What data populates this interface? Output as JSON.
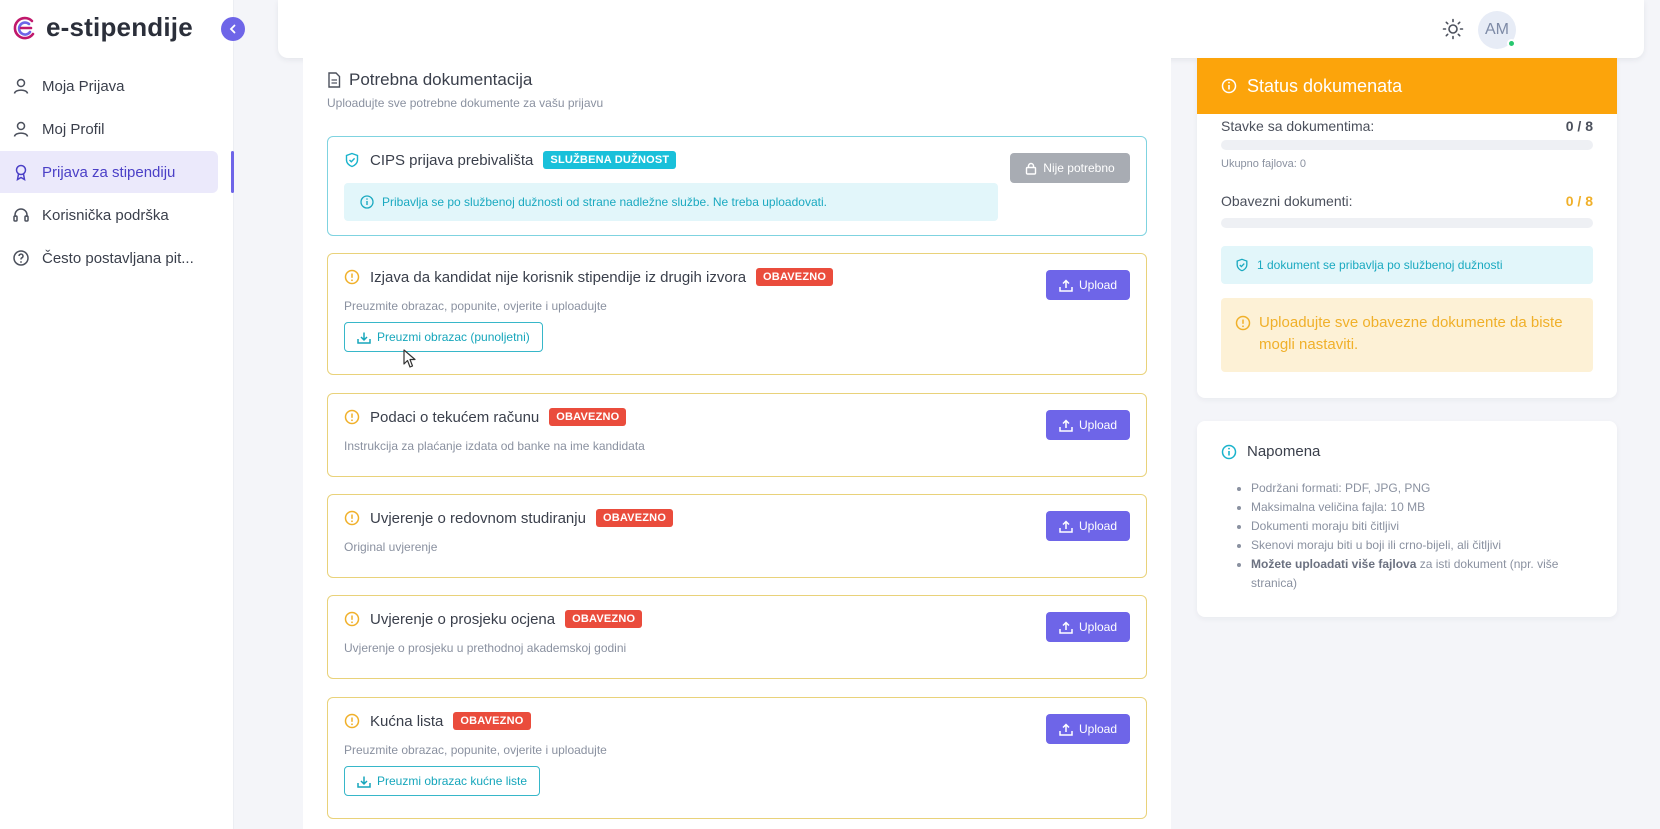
{
  "brand": {
    "name": "e-stipendije"
  },
  "sidebar": {
    "items": [
      {
        "label": "Moja Prijava",
        "icon": "user-icon",
        "active": false
      },
      {
        "label": "Moj Profil",
        "icon": "user-icon",
        "active": false
      },
      {
        "label": "Prijava za stipendiju",
        "icon": "award-icon",
        "active": true
      },
      {
        "label": "Korisnička podrška",
        "icon": "headset-icon",
        "active": false
      },
      {
        "label": "Često postavljana pit...",
        "icon": "help-circle-icon",
        "active": false
      }
    ]
  },
  "header": {
    "avatar_initials": "AM",
    "theme_icon": "sun-icon"
  },
  "documents": {
    "title": "Potrebna dokumentacija",
    "subtitle": "Uploadujte sve potrebne dokumente za vašu prijavu",
    "items": [
      {
        "title": "CIPS prijava prebivališta",
        "badge": "SLUŽBENA DUŽNOST",
        "info": "Pribavlja se po službenoj dužnosti od strane nadležne službe. Ne treba uploadovati.",
        "action": "Nije potrebno"
      },
      {
        "title": "Izjava da kandidat nije korisnik stipendije iz drugih izvora",
        "badge": "OBAVEZNO",
        "description": "Preuzmite obrazac, popunite, ovjerite i uploadujte",
        "form_button": "Preuzmi obrazac (punoljetni)",
        "action": "Upload"
      },
      {
        "title": "Podaci o tekućem računu",
        "badge": "OBAVEZNO",
        "description": "Instrukcija za plaćanje izdata od banke na ime kandidata",
        "action": "Upload"
      },
      {
        "title": "Uvjerenje o redovnom studiranju",
        "badge": "OBAVEZNO",
        "description": "Original uvjerenje",
        "action": "Upload"
      },
      {
        "title": "Uvjerenje o prosjeku ocjena",
        "badge": "OBAVEZNO",
        "description": "Uvjerenje o prosjeku u prethodnoj akademskoj godini",
        "action": "Upload"
      },
      {
        "title": "Kućna lista",
        "badge": "OBAVEZNO",
        "description": "Preuzmite obrazac, popunite, ovjerite i uploadujte",
        "form_button": "Preuzmi obrazac kućne liste",
        "action": "Upload"
      }
    ]
  },
  "status": {
    "title": "Status dokumenata",
    "items_label": "Stavke sa dokumentima:",
    "items_value": "0 / 8",
    "items_progress": 0,
    "total_files": "Ukupno fajlova: 0",
    "required_label": "Obavezni dokumenti:",
    "required_value": "0 / 8",
    "required_progress": 0,
    "official_note": "1 dokument se pribavlja po službenoj dužnosti",
    "warning": "Uploadujte sve obavezne dokumente da biste mogli nastaviti."
  },
  "note": {
    "title": "Napomena",
    "items": [
      "Podržani formati: PDF, JPG, PNG",
      "Maksimalna veličina fajla: 10 MB",
      "Dokumenti moraju biti čitljivi",
      "Skenovi moraju biti u boji ili crno-bijeli, ali čitljivi"
    ],
    "last_bold": "Možete uploadati više fajlova",
    "last_rest": " za isti dokument (npr. više stranica)"
  },
  "colors": {
    "accent": "#6e65e8",
    "warning": "#fca40b",
    "required": "#ea4c3c",
    "info": "#19c0da",
    "card_border": "#e9d27a"
  }
}
